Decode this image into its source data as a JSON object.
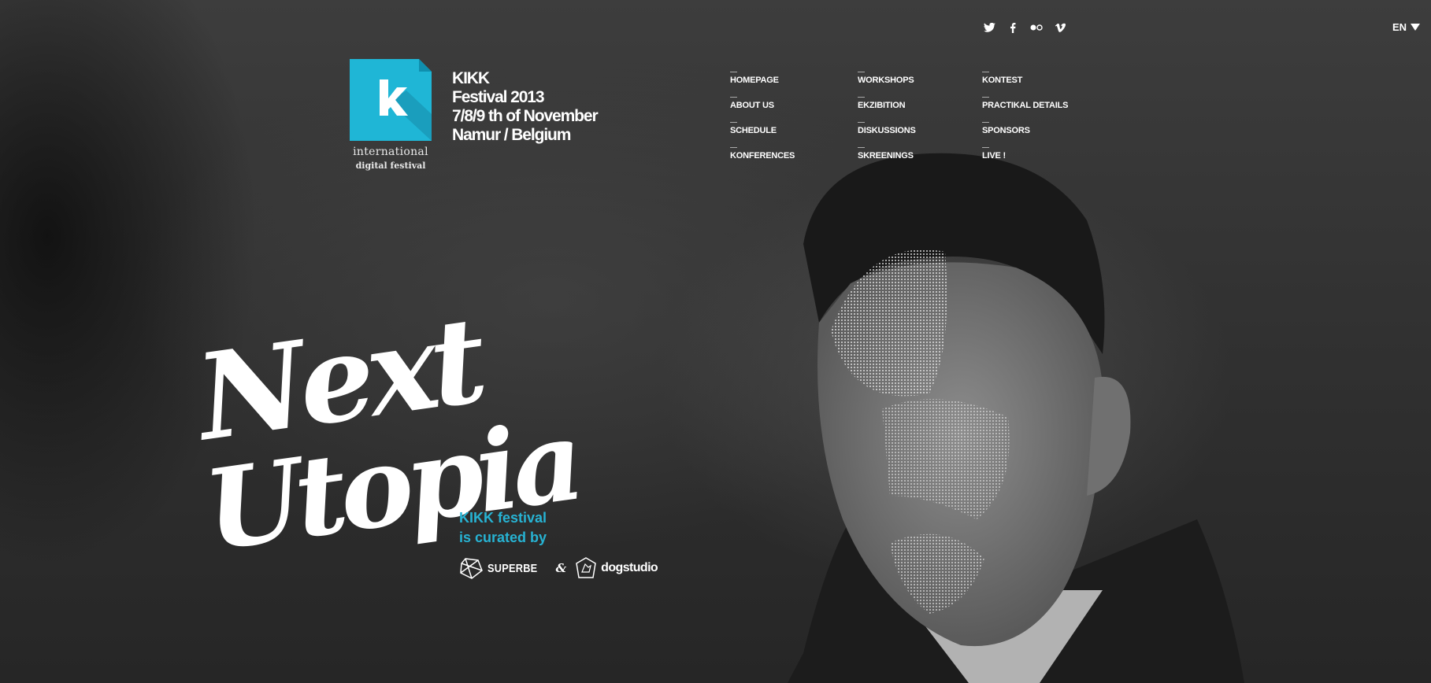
{
  "social": {
    "icons": [
      "twitter-icon",
      "facebook-icon",
      "flickr-icon",
      "vimeo-icon"
    ]
  },
  "language": {
    "current": "EN"
  },
  "logo": {
    "line1": "international",
    "line2": "digital festival",
    "accent_color": "#1fb6d6"
  },
  "festival": {
    "name": "KIKK",
    "edition": "Festival 2013",
    "dates": "7/8/9 th of November",
    "location": "Namur / Belgium"
  },
  "nav": {
    "items": [
      "HOMEPAGE",
      "ABOUT US",
      "SCHEDULE",
      "KONFERENCES",
      "WORKSHOPS",
      "EKZIBITION",
      "DISKUSSIONS",
      "SKREENINGS",
      "KONTEST",
      "PRACTIKAL DETAILS",
      "SPONSORS",
      "LIVE !"
    ]
  },
  "headline": {
    "line1": "Next",
    "line2": "Utopia"
  },
  "curated": {
    "line1": "KIKK festival",
    "line2": "is curated by",
    "color": "#27b3d3",
    "partners": [
      "SUPERBE",
      "dogstudio"
    ],
    "separator": "&"
  }
}
